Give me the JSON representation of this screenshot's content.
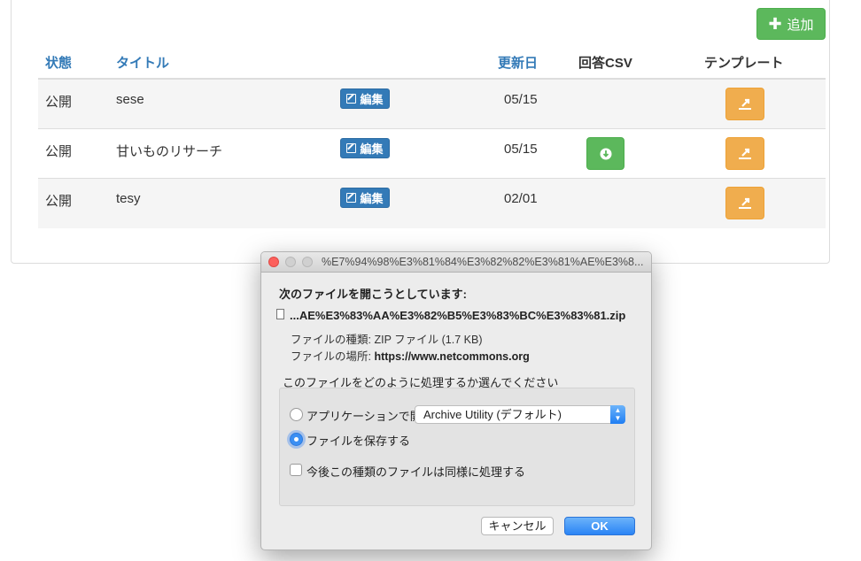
{
  "toolbar": {
    "add_label": "追加",
    "add_icon": "plus-icon"
  },
  "table": {
    "headers": {
      "status": "状態",
      "title": "タイトル",
      "updated": "更新日",
      "csv": "回答CSV",
      "template": "テンプレート"
    },
    "edit_label": "編集",
    "rows": [
      {
        "status": "公開",
        "title": "sese",
        "date": "05/15",
        "has_csv": false
      },
      {
        "status": "公開",
        "title": "甘いものリサーチ",
        "date": "05/15",
        "has_csv": true
      },
      {
        "status": "公開",
        "title": "tesy",
        "date": "02/01",
        "has_csv": false
      }
    ]
  },
  "dialog": {
    "title": "%E7%94%98%E3%81%84%E3%82%82%E3%81%AE%E3%8...",
    "heading": "次のファイルを開こうとしています:",
    "filename": "...AE%E3%83%AA%E3%82%B5%E3%83%BC%E3%83%81.zip",
    "type_label": "ファイルの種類:",
    "type_value": "ZIP ファイル (1.7 KB)",
    "source_label": "ファイルの場所:",
    "source_value": "https://www.netcommons.org",
    "choose_prompt": "このファイルをどのように処理するか選んでください",
    "open_with_label": "アプリケーションで開く:",
    "open_with_value": "Archive Utility (デフォルト)",
    "save_label": "ファイルを保存する",
    "selected_option": "save",
    "remember_label": "今後この種類のファイルは同様に処理する",
    "remember_checked": false,
    "cancel_label": "キャンセル",
    "ok_label": "OK"
  },
  "colors": {
    "success": "#5cb85c",
    "primary": "#337ab7",
    "warning": "#f0ad4e",
    "mac_blue": "#2a84f5"
  }
}
